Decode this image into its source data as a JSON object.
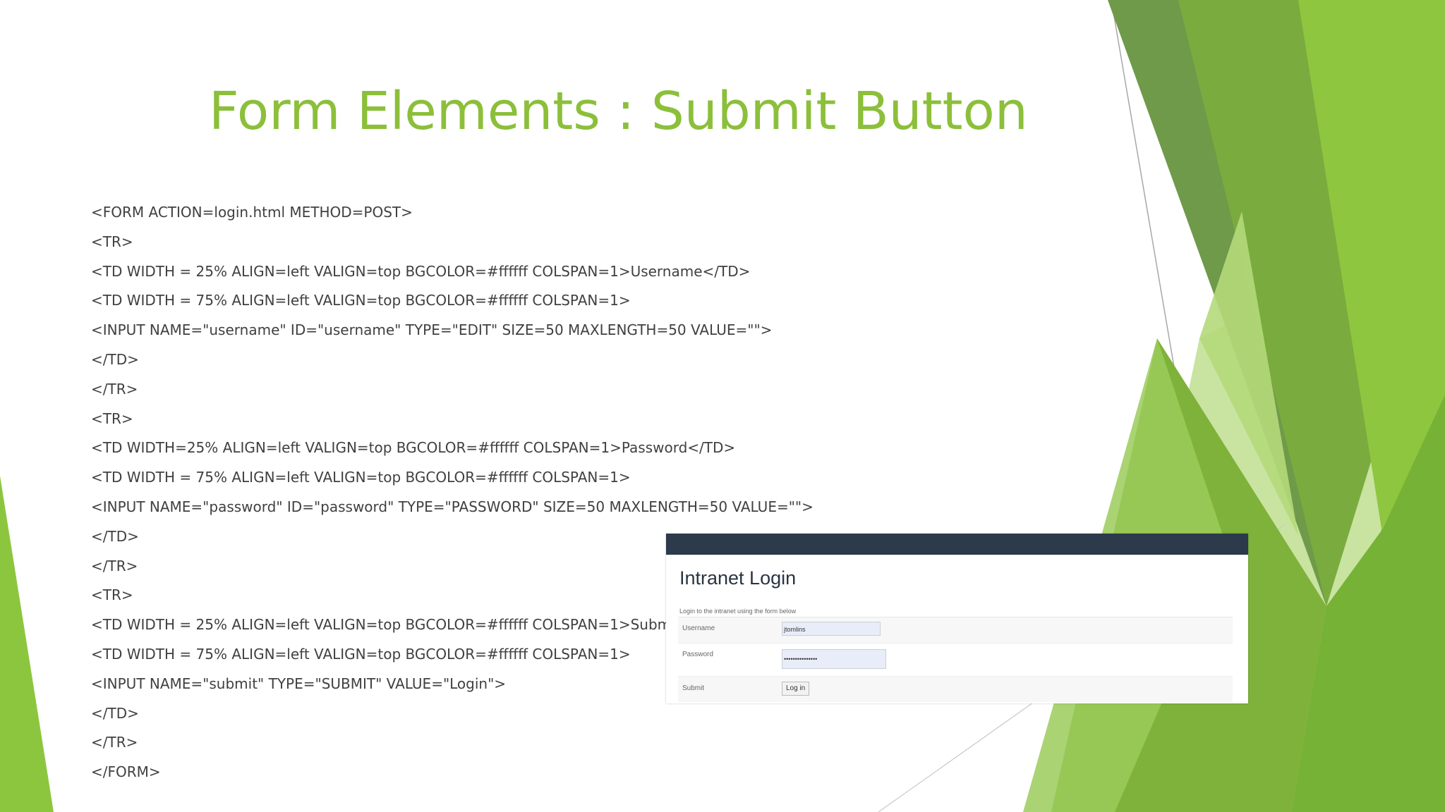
{
  "slide": {
    "title": "Form Elements : Submit Button",
    "code_lines": [
      "<FORM ACTION=login.html METHOD=POST>",
      "<TR>",
      "<TD WIDTH = 25% ALIGN=left VALIGN=top BGCOLOR=#ffffff COLSPAN=1>Username</TD>",
      "<TD WIDTH = 75% ALIGN=left VALIGN=top BGCOLOR=#ffffff COLSPAN=1>",
      "<INPUT NAME=\"username\" ID=\"username\" TYPE=\"EDIT\" SIZE=50 MAXLENGTH=50 VALUE=\"\">",
      "</TD>",
      "</TR>",
      "<TR>",
      "<TD WIDTH=25% ALIGN=left VALIGN=top BGCOLOR=#ffffff COLSPAN=1>Password</TD>",
      "<TD WIDTH = 75% ALIGN=left VALIGN=top BGCOLOR=#ffffff COLSPAN=1>",
      "<INPUT NAME=\"password\" ID=\"password\" TYPE=\"PASSWORD\" SIZE=50 MAXLENGTH=50 VALUE=\"\">",
      "</TD>",
      "</TR>",
      "<TR>",
      "<TD WIDTH = 25% ALIGN=left VALIGN=top BGCOLOR=#ffffff COLSPAN=1>Submit</TD>",
      "<TD WIDTH = 75% ALIGN=left VALIGN=top BGCOLOR=#ffffff COLSPAN=1>",
      "<INPUT NAME=\"submit\" TYPE=\"SUBMIT\" VALUE=\"Login\">",
      "</TD>",
      "</TR>",
      "</FORM>"
    ]
  },
  "screenshot": {
    "heading": "Intranet Login",
    "description": "Login to the intranet using the form below",
    "username_label": "Username",
    "username_value": "jtomlins",
    "password_label": "Password",
    "password_value": "•••••••••••••••",
    "submit_label": "Submit",
    "submit_button": "Log in"
  },
  "colors": {
    "accent": "#8cbf3a",
    "navbar": "#2c3a4b"
  }
}
